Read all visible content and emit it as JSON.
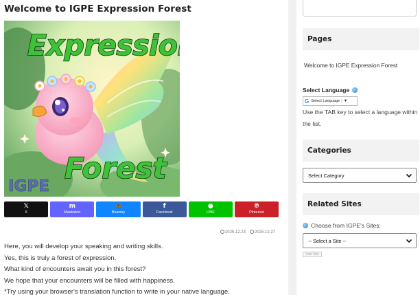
{
  "post": {
    "title": "Welcome to IGPE Expression Forest",
    "hero_image": {
      "title_top": "Expression",
      "title_bottom": "Forest",
      "logo": "IGPE"
    },
    "share_buttons": [
      {
        "label": "X",
        "icon": "x-icon",
        "glyph": "𝕏",
        "color": "#111111"
      },
      {
        "label": "Mastodon",
        "icon": "mastodon-icon",
        "glyph": "m",
        "color": "#6364ff"
      },
      {
        "label": "Bluesky",
        "icon": "bluesky-icon",
        "glyph": "🦋",
        "color": "#1185fe"
      },
      {
        "label": "Facebook",
        "icon": "facebook-icon",
        "glyph": "f",
        "color": "#3b5998"
      },
      {
        "label": "LINE",
        "icon": "line-icon",
        "glyph": "●",
        "color": "#00c300"
      },
      {
        "label": "Pinterest",
        "icon": "pinterest-icon",
        "glyph": "℗",
        "color": "#cb2027"
      }
    ],
    "published_date": "2025.12.23",
    "updated_date": "2025.12.27",
    "paragraphs": [
      "Here, you will develop your speaking and writing skills.",
      "Yes, this is truly a forest of expression.",
      "What kind of encounters await you in this forest?",
      "We hope that your encounters will be filled with happiness.",
      "*Try using your browser's translation function to write in your native language."
    ]
  },
  "sidebar": {
    "search_placeholder": "",
    "pages": {
      "heading": "Pages",
      "items": [
        "Welcome to IGPE Expression Forest"
      ]
    },
    "language": {
      "label": "Select Language",
      "widget_text": "Select Language",
      "widget_arrow": "▼",
      "help": "Use the TAB key to select a language within the list."
    },
    "categories": {
      "heading": "Categories",
      "selected": "Select Category"
    },
    "related": {
      "heading": "Related Sites",
      "label": "Choose from IGPE's Sites:",
      "selected": "-- Select a Site --",
      "button": "Visit Site"
    }
  },
  "colors": {
    "widget_heading_bg": "#f2f2f2",
    "hero_title_green": "#3fc13a",
    "gutter": "#f1f1f1"
  }
}
